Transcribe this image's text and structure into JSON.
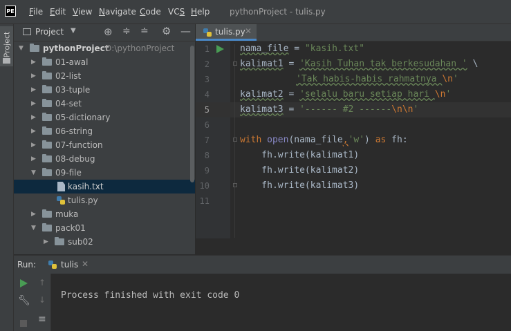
{
  "app": {
    "logo": "PE",
    "window_title": "pythonProject - tulis.py"
  },
  "menu": [
    "File",
    "Edit",
    "View",
    "Navigate",
    "Code",
    "VCS",
    "Help"
  ],
  "menu_mnemonics": [
    "F",
    "E",
    "V",
    "N",
    "C",
    "S",
    "H"
  ],
  "left_strip": {
    "project_tab": "Project"
  },
  "project_panel": {
    "title": "Project",
    "root": {
      "name": "pythonProject",
      "path": "D:\\pythonProject"
    },
    "folders": [
      "01-awal",
      "02-list",
      "03-tuple",
      "04-set",
      "05-dictionary",
      "06-string",
      "07-function",
      "08-debug",
      "09-file"
    ],
    "files_in_09": [
      "kasih.txt",
      "tulis.py"
    ],
    "more_folders": [
      "muka",
      "pack01"
    ],
    "sub": [
      "sub02"
    ]
  },
  "editor": {
    "tab_label": "tulis.py",
    "line_numbers": [
      "1",
      "2",
      "3",
      "4",
      "5",
      "6",
      "7",
      "8",
      "9",
      "10",
      "11"
    ],
    "current_line": "5"
  },
  "code": {
    "l1": {
      "var": "nama_file",
      "op": " = ",
      "str": "\"kasih.txt\""
    },
    "l2": {
      "var": "kalimat1",
      "op": " = ",
      "str": "'Kasih Tuhan tak berkesudahan '",
      "tail": " \\"
    },
    "l3": {
      "str_a": "'Tak habis-habis rahmatnya ",
      "esc": "\\n",
      "str_b": "'"
    },
    "l4": {
      "var": "kalimat2",
      "op": " = ",
      "str_a": "'selalu baru setiap hari ",
      "esc": "\\n",
      "str_b": "'"
    },
    "l5": {
      "var": "kalimat3",
      "op": " = ",
      "str_a": "'------ #2 ------",
      "esc": "\\n\\n",
      "str_b": "'"
    },
    "l7": {
      "kw": "with",
      "fn": "open",
      "args_a": "(nama_file",
      "comma": ",",
      "arg_str": "'w'",
      "args_b": ") ",
      "as": "as",
      "tail": " fh:"
    },
    "l8": "    fh.write(kalimat1)",
    "l9": "    fh.write(kalimat2)",
    "l10": "    fh.write(kalimat3)"
  },
  "run_panel": {
    "label": "Run:",
    "tab": "tulis",
    "console_output": "Process finished with exit code 0"
  },
  "colors": {
    "accent": "#4a88c7",
    "string": "#6a8759",
    "keyword": "#cc7832",
    "run_green": "#499c54"
  }
}
